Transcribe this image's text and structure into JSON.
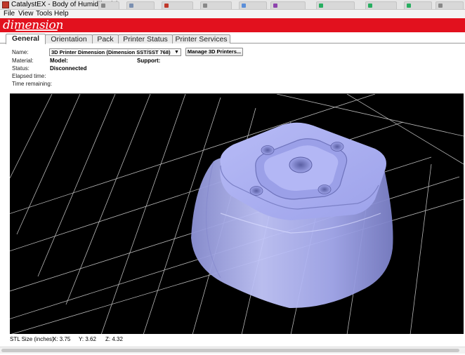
{
  "window": {
    "title": "CatalystEX - Body of Humidifer (1)"
  },
  "menu": {
    "items": [
      "File",
      "View",
      "Tools",
      "Help"
    ]
  },
  "brand": {
    "logo_text": "dimension",
    "color": "#e2111e"
  },
  "tabs": [
    "General",
    "Orientation",
    "Pack",
    "Printer Status",
    "Printer Services"
  ],
  "general": {
    "name_label": "Name:",
    "printer_select_value": "3D Printer Dimension  (Dimension SST/SST 768)",
    "manage_button_label": "Manage 3D Printers...",
    "material_label": "Material:",
    "model_label": "Model:",
    "support_label": "Support:",
    "status_label": "Status:",
    "status_value": "Disconnected",
    "elapsed_label": "Elapsed time:",
    "remaining_label": "Time remaining:"
  },
  "viewport": {
    "background": "#000000",
    "grid_color": "#d9d9d9",
    "model_color": "#a9aef0"
  },
  "status": {
    "stl_label": "STL Size (inches)",
    "x": "X: 3.75",
    "y": "Y: 3.62",
    "z": "Z: 4.32"
  }
}
